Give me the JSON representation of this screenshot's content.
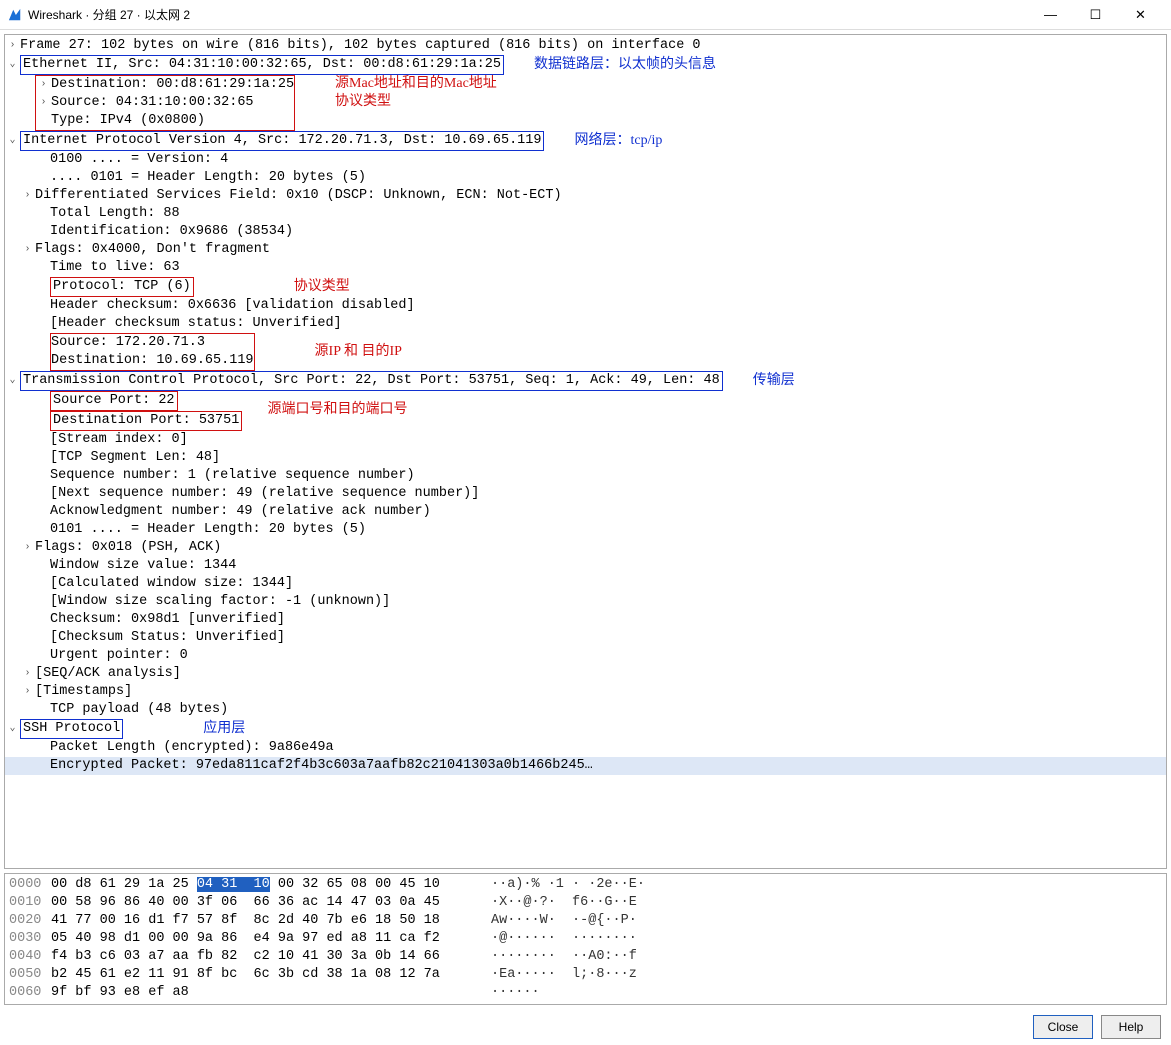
{
  "window": {
    "title": "Wireshark · 分组 27 · 以太网 2",
    "min": "—",
    "max": "☐",
    "close": "✕"
  },
  "tree": {
    "frame": "Frame 27: 102 bytes on wire (816 bits), 102 bytes captured (816 bits) on interface 0",
    "eth": {
      "summary": "Ethernet II, Src: 04:31:10:00:32:65, Dst: 00:d8:61:29:1a:25",
      "anno": "数据链路层：以太帧的头信息",
      "dst": "Destination: 00:d8:61:29:1a:25",
      "src": "Source: 04:31:10:00:32:65",
      "type": "Type: IPv4 (0x0800)",
      "mac_anno": "源Mac地址和目的Mac地址",
      "type_anno": "协议类型"
    },
    "ip": {
      "summary": "Internet Protocol Version 4, Src: 172.20.71.3, Dst: 10.69.65.119",
      "anno": "网络层：tcp/ip",
      "version": "0100 .... = Version: 4",
      "hlen": ".... 0101 = Header Length: 20 bytes (5)",
      "dsf": "Differentiated Services Field: 0x10 (DSCP: Unknown, ECN: Not-ECT)",
      "tlen": "Total Length: 88",
      "id": "Identification: 0x9686 (38534)",
      "flags": "Flags: 0x4000, Don't fragment",
      "ttl": "Time to live: 63",
      "proto": "Protocol: TCP (6)",
      "proto_anno": "协议类型",
      "chksum": "Header checksum: 0x6636 [validation disabled]",
      "chkstatus": "[Header checksum status: Unverified]",
      "src": "Source: 172.20.71.3",
      "dst": "Destination: 10.69.65.119",
      "ip_anno": "源IP 和 目的IP"
    },
    "tcp": {
      "summary": "Transmission Control Protocol, Src Port: 22, Dst Port: 53751, Seq: 1, Ack: 49, Len: 48",
      "anno": "传输层",
      "sport": "Source Port: 22",
      "dport": "Destination Port: 53751",
      "port_anno": "源端口号和目的端口号",
      "sidx": "[Stream index: 0]",
      "seglen": "[TCP Segment Len: 48]",
      "seq": "Sequence number: 1    (relative sequence number)",
      "nseq": "[Next sequence number: 49    (relative sequence number)]",
      "ack": "Acknowledgment number: 49    (relative ack number)",
      "hlen": "0101 .... = Header Length: 20 bytes (5)",
      "flags": "Flags: 0x018 (PSH, ACK)",
      "win": "Window size value: 1344",
      "cwin": "[Calculated window size: 1344]",
      "wscale": "[Window size scaling factor: -1 (unknown)]",
      "chksum": "Checksum: 0x98d1 [unverified]",
      "chkstatus": "[Checksum Status: Unverified]",
      "urg": "Urgent pointer: 0",
      "seqack": "[SEQ/ACK analysis]",
      "ts": "[Timestamps]",
      "payload": "TCP payload (48 bytes)"
    },
    "ssh": {
      "summary": "SSH Protocol",
      "anno": "应用层",
      "plen": "Packet Length (encrypted): 9a86e49a",
      "enc": "Encrypted Packet: 97eda811caf2f4b3c603a7aafb82c21041303a0b1466b245…"
    }
  },
  "hex": [
    {
      "off": "0000",
      "b1": "00 d8 61 29 1a 25 ",
      "hl": "04 31  10",
      "b2": " 00 32 65 08 00 45 10",
      "asc": "··a)·% ·1 · ·2e··E·"
    },
    {
      "off": "0010",
      "b1": "00 58 96 86 40 00 3f 06  66 36 ac 14 47 03 0a 45",
      "hl": "",
      "b2": "",
      "asc": "·X··@·?·  f6··G··E"
    },
    {
      "off": "0020",
      "b1": "41 77 00 16 d1 f7 57 8f  8c 2d 40 7b e6 18 50 18",
      "hl": "",
      "b2": "",
      "asc": "Aw····W·  ·-@{··P·"
    },
    {
      "off": "0030",
      "b1": "05 40 98 d1 00 00 9a 86  e4 9a 97 ed a8 11 ca f2",
      "hl": "",
      "b2": "",
      "asc": "·@······  ········"
    },
    {
      "off": "0040",
      "b1": "f4 b3 c6 03 a7 aa fb 82  c2 10 41 30 3a 0b 14 66",
      "hl": "",
      "b2": "",
      "asc": "········  ··A0:··f"
    },
    {
      "off": "0050",
      "b1": "b2 45 61 e2 11 91 8f bc  6c 3b cd 38 1a 08 12 7a",
      "hl": "",
      "b2": "",
      "asc": "·Ea·····  l;·8···z"
    },
    {
      "off": "0060",
      "b1": "9f bf 93 e8 ef a8",
      "hl": "",
      "b2": "",
      "asc": "······"
    }
  ],
  "footer": {
    "close": "Close",
    "help": "Help"
  }
}
